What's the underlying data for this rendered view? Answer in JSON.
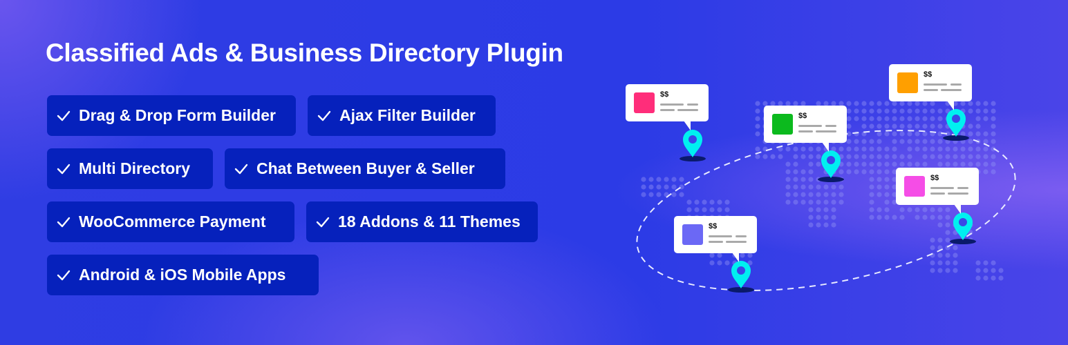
{
  "banner": {
    "title": "Classified Ads & Business Directory Plugin",
    "features": [
      {
        "label": "Drag & Drop Form Builder"
      },
      {
        "label": "Ajax Filter Builder"
      },
      {
        "label": "Multi Directory"
      },
      {
        "label": "Chat Between Buyer & Seller"
      },
      {
        "label": "WooCommerce Payment"
      },
      {
        "label": "18 Addons & 11 Themes"
      },
      {
        "label": "Android & iOS Mobile Apps"
      }
    ],
    "check_icon": "checkmark-icon"
  },
  "illustration": {
    "listings": [
      {
        "price": "$$",
        "color": "#ff2d7a"
      },
      {
        "price": "$$",
        "color": "#0cba1e"
      },
      {
        "price": "$$",
        "color": "#ff9f00"
      },
      {
        "price": "$$",
        "color": "#f54de6"
      },
      {
        "price": "$$",
        "color": "#6b68f5"
      }
    ],
    "pin_color": "#00f0f0",
    "shadow_color": "#0a1a6b"
  }
}
